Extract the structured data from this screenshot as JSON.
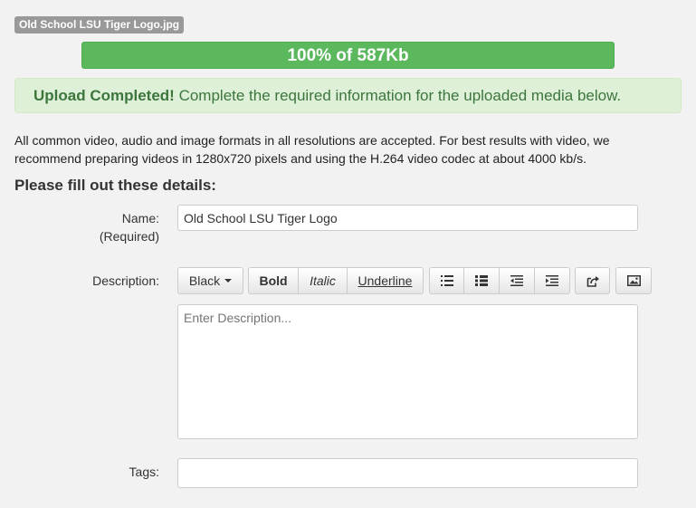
{
  "file": {
    "name": "Old School LSU Tiger Logo.jpg"
  },
  "progress": {
    "text": "100% of 587Kb",
    "percent": 100,
    "color": "#5cb85c"
  },
  "alert": {
    "strong": "Upload Completed!",
    "message": " Complete the required information for the uploaded media below.",
    "color": "#3c763d"
  },
  "intro": {
    "text": "All common video, audio and image formats in all resolutions are accepted.  For best results with video, we recommend preparing videos in 1280x720 pixels and using the H.264 video codec at about 4000 kb/s."
  },
  "form": {
    "title": "Please fill out these details:",
    "name": {
      "label": "Name:",
      "required": "(Required)",
      "value": "Old School LSU Tiger Logo"
    },
    "description": {
      "label": "Description:",
      "placeholder": "Enter Description...",
      "toolbar": {
        "color_label": "Black",
        "bold_label": "Bold",
        "italic_label": "Italic",
        "underline_label": "Underline",
        "icons": [
          "unordered-list-icon",
          "ordered-list-icon",
          "outdent-icon",
          "indent-icon",
          "link-icon",
          "image-icon"
        ]
      }
    },
    "tags": {
      "label": "Tags:",
      "value": ""
    }
  }
}
